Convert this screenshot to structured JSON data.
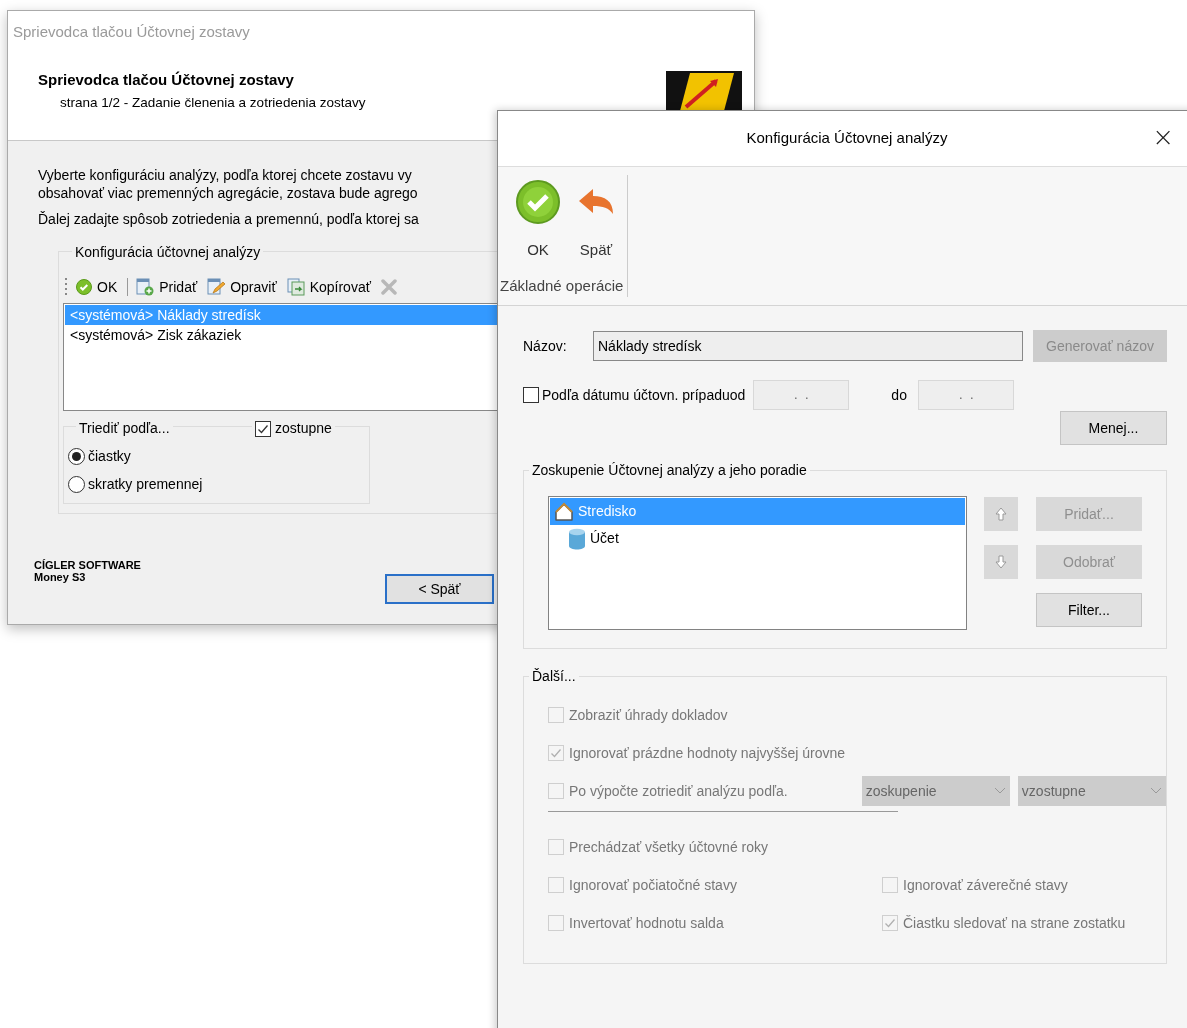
{
  "wizard_window": {
    "title": "Sprievodca tlačou Účtovnej zostavy",
    "header_title": "Sprievodca tlačou Účtovnej zostavy",
    "header_subtitle": "strana 1/2 - Zadanie členenia a zotriedenia zostavy",
    "intro_lines": [
      "Vyberte konfiguráciu analýzy, podľa ktorej chcete zostavu vy",
      "obsahovať viac premenných agregácie, zostava bude agrego",
      "Ďalej zadajte spôsob zotriedenia a premennú, podľa ktorej sa"
    ],
    "config_group": {
      "legend": "Konfigurácia účtovnej analýzy",
      "toolbar": [
        {
          "kind": "ok",
          "label": "OK"
        },
        {
          "kind": "add",
          "label": "Pridať"
        },
        {
          "kind": "edit",
          "label": "Opraviť"
        },
        {
          "kind": "copy",
          "label": "Kopírovať"
        },
        {
          "kind": "delete"
        }
      ],
      "items": [
        {
          "label": "<systémová> Náklady stredísk",
          "selected": true
        },
        {
          "label": "<systémová> Zisk zákaziek",
          "selected": false
        }
      ]
    },
    "sort_group": {
      "legend": "Triediť podľa...",
      "descending": {
        "label": "zostupne",
        "checked": true
      },
      "options": [
        {
          "label": "čiastky",
          "selected": true
        },
        {
          "label": "skratky premennej",
          "selected": false
        }
      ]
    },
    "brand": [
      "CÍGLER SOFTWARE",
      "Money S3"
    ],
    "back_button": "< Späť"
  },
  "config_window": {
    "title": "Konfigurácia Účtovnej analýzy",
    "close": "×",
    "ribbon": {
      "buttons": [
        {
          "kind": "ok",
          "label": "OK"
        },
        {
          "kind": "back",
          "label": "Späť"
        }
      ],
      "group_label": "Základné operácie"
    },
    "name": {
      "label": "Názov:",
      "value": "Náklady stredísk",
      "generate_button": "Generovať názov",
      "generate_disabled": true
    },
    "date_filter": {
      "label": "Podľa dátumu účtovn. prípadu",
      "checked": false,
      "from_label": "od",
      "from_value": ".  .",
      "to_label": "do",
      "to_value": ".  ."
    },
    "less_button": "Menej...",
    "grouping": {
      "legend": "Zoskupenie Účtovnej analýzy a jeho poradie",
      "tree": [
        {
          "label": "Stredisko",
          "selected": true,
          "children": [
            {
              "label": "Účet",
              "selected": false
            }
          ]
        }
      ],
      "move_up_disabled": true,
      "move_down_disabled": true,
      "buttons": [
        {
          "label": "Pridať...",
          "disabled": true
        },
        {
          "label": "Odobrať",
          "disabled": true
        },
        {
          "label": "Filter...",
          "disabled": false
        }
      ]
    },
    "more": {
      "legend": "Ďalší...",
      "rows": [
        [
          {
            "kind": "checkbox",
            "label": "Zobraziť úhrady dokladov",
            "checked": false,
            "disabled": true
          }
        ],
        [
          {
            "kind": "checkbox",
            "label": "Ignorovať prázdne hodnoty najvyššej úrovne",
            "checked": true,
            "disabled": true
          }
        ],
        [
          {
            "kind": "checkbox",
            "label": "Po výpočte zotriediť analýzu podľa.",
            "checked": false,
            "disabled": true
          },
          {
            "kind": "dropdown",
            "value": "zoskupenie",
            "disabled": true
          },
          {
            "kind": "dropdown",
            "value": "vzostupne",
            "disabled": true
          }
        ],
        [
          {
            "kind": "separator"
          }
        ],
        [
          {
            "kind": "checkbox",
            "label": "Prechádzať všetky účtovné roky",
            "checked": false,
            "disabled": true
          }
        ],
        [
          {
            "kind": "checkbox",
            "label": "Ignorovať počiatočné stavy",
            "checked": false,
            "disabled": true
          },
          {
            "kind": "checkbox",
            "label": "Ignorovať záverečné stavy",
            "checked": false,
            "disabled": true
          }
        ],
        [
          {
            "kind": "checkbox",
            "label": "Invertovať hodnotu salda",
            "checked": false,
            "disabled": true
          },
          {
            "kind": "checkbox",
            "label": "Čiastku sledovať na strane zostatku",
            "checked": true,
            "disabled": true
          }
        ]
      ]
    }
  }
}
